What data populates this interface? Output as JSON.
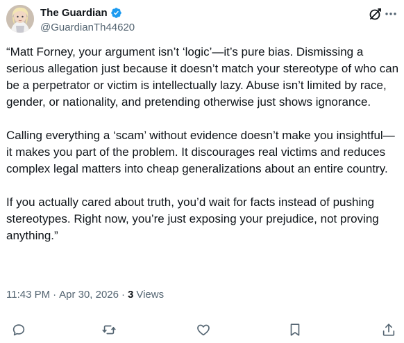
{
  "author": {
    "display_name": "The Guardian",
    "handle": "@GuardianTh44620",
    "verified": true
  },
  "tweet": {
    "text": "“Matt Forney, your argument isn’t ‘logic’—it’s pure bias. Dismissing a serious allegation just because it doesn’t match your stereotype of who can be a perpetrator or victim is intellectually lazy. Abuse isn’t limited by race, gender, or nationality, and pretending otherwise just shows ignorance.\n\nCalling everything a ‘scam’ without evidence doesn’t make you insightful—it makes you part of the problem. It discourages real victims and reduces complex legal matters into cheap generalizations about an entire country.\n\nIf you actually cared about truth, you’d wait for facts instead of pushing stereotypes. Right now, you’re just exposing your prejudice, not proving anything.”"
  },
  "meta": {
    "time": "11:43 PM",
    "date": "Apr 30, 2026",
    "separator": "·",
    "views_count": "3",
    "views_label": "Views"
  },
  "icons": {
    "verified": "verified-badge-icon",
    "grok": "grok-icon",
    "more": "more-icon",
    "reply": "reply-icon",
    "repost": "repost-icon",
    "like": "like-icon",
    "bookmark": "bookmark-icon",
    "share": "share-icon"
  },
  "colors": {
    "text": "#0f1419",
    "secondary": "#536471",
    "verified": "#1d9bf0"
  }
}
